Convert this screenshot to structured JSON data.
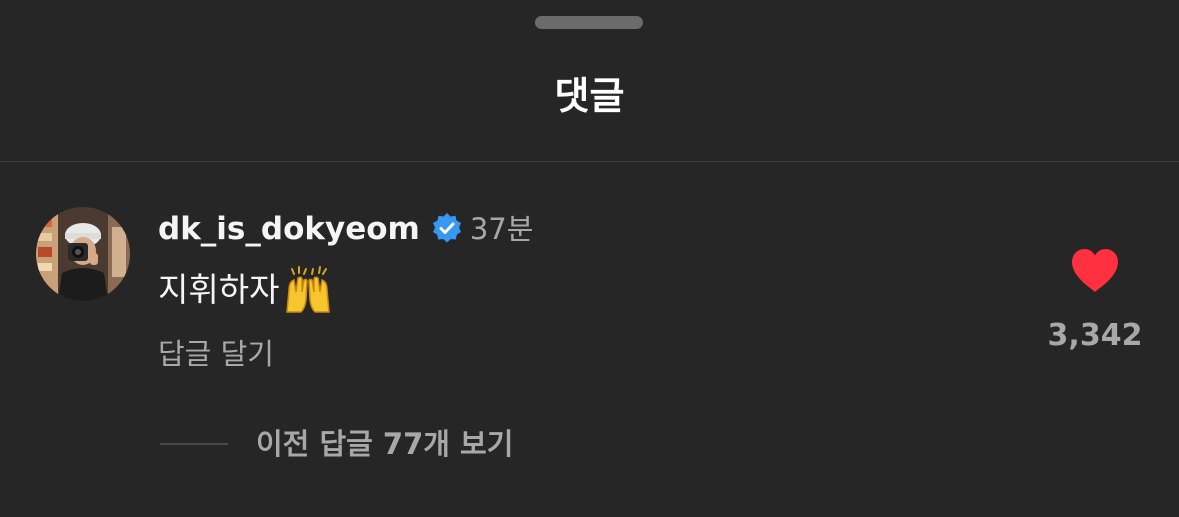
{
  "header": {
    "title": "댓글"
  },
  "comment": {
    "username": "dk_is_dokyeom",
    "verified": true,
    "time": "37분",
    "text": "지휘하자",
    "emoji": "raised-hands-emoji",
    "reply_label": "답글 달기",
    "like_count": "3,342",
    "liked": true,
    "like_color": "#ff3040",
    "view_replies_label": "이전 답글 77개 보기"
  },
  "colors": {
    "background": "#262626",
    "primary_text": "#f5f5f5",
    "secondary_text": "#a8a8a8",
    "verified_badge": "#3897f0"
  }
}
